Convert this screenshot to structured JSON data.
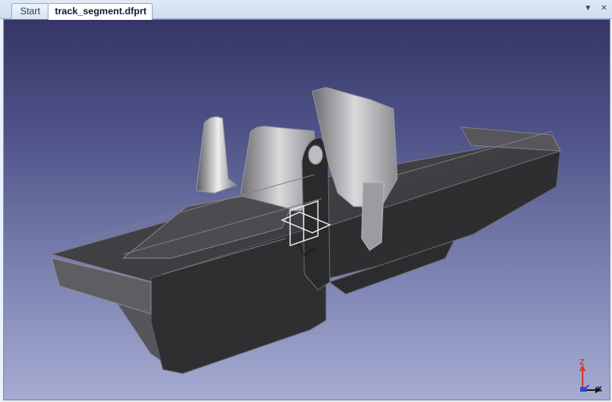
{
  "tabs": [
    {
      "label": "Start",
      "active": false
    },
    {
      "label": "track_segment.dfprt",
      "active": true
    }
  ],
  "tabbar_controls": [
    "chevron-down-icon",
    "close-icon"
  ],
  "viewport": {
    "background_top": "#353667",
    "background_bottom": "#a6acd1",
    "model_color": "#3d3d40"
  },
  "axis": {
    "z_label": "Z",
    "x_label": "X",
    "z_color": "#d33b2f",
    "x_color": "#1b1b1b"
  }
}
